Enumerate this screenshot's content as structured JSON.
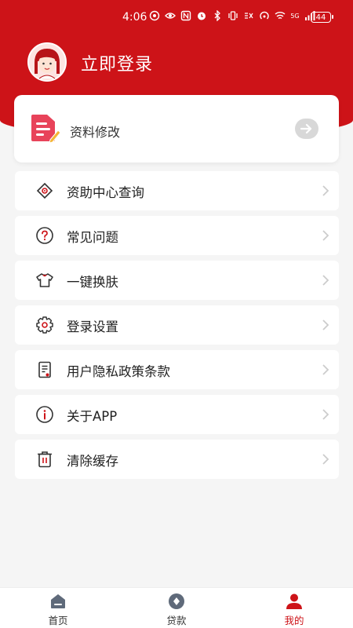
{
  "status_bar": {
    "time": "4:06",
    "battery": "44",
    "network_label": "5G"
  },
  "header": {
    "login_label": "立即登录"
  },
  "profile_card": {
    "label": "资料修改"
  },
  "menu": [
    {
      "label": "资助中心查询",
      "icon": "diamond-eye-icon"
    },
    {
      "label": "常见问题",
      "icon": "question-icon"
    },
    {
      "label": "一键换肤",
      "icon": "shirt-icon"
    },
    {
      "label": "登录设置",
      "icon": "gear-icon"
    },
    {
      "label": "用户隐私政策条款",
      "icon": "document-icon"
    },
    {
      "label": "关于APP",
      "icon": "info-icon"
    },
    {
      "label": "清除缓存",
      "icon": "trash-icon"
    }
  ],
  "tabbar": {
    "tabs": [
      {
        "label": "首页",
        "icon": "home-icon"
      },
      {
        "label": "贷款",
        "icon": "coin-icon"
      },
      {
        "label": "我的",
        "icon": "user-icon"
      }
    ],
    "active_index": 2
  },
  "colors": {
    "accent": "#cd1318",
    "background": "#f5f5f5"
  }
}
